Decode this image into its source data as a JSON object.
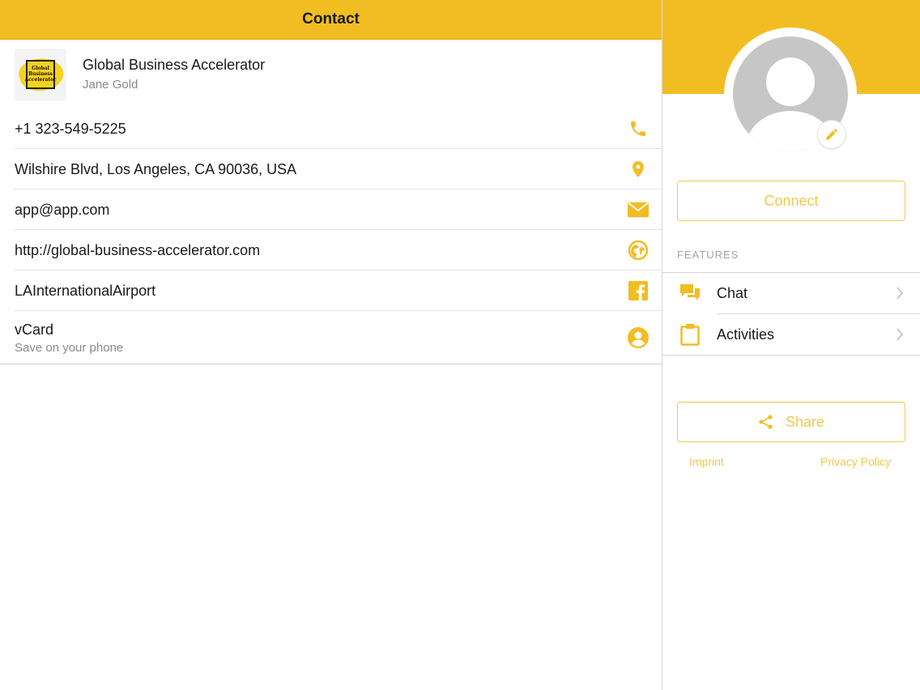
{
  "colors": {
    "accent": "#f1bd22",
    "accent_light": "#f1c84c",
    "icon": "#f1bd22"
  },
  "header": {
    "title": "Contact"
  },
  "company": {
    "logo_text": "Global Business Accelerator",
    "name": "Global Business Accelerator",
    "person": "Jane Gold"
  },
  "contact_rows": [
    {
      "text": "+1 323-549-5225",
      "icon": "phone-icon"
    },
    {
      "text": "Wilshire Blvd, Los Angeles, CA 90036, USA",
      "icon": "location-pin-icon"
    },
    {
      "text": "app@app.com",
      "icon": "envelope-icon"
    },
    {
      "text": "http://global-business-accelerator.com",
      "icon": "globe-icon"
    },
    {
      "text": "LAInternationalAirport",
      "icon": "facebook-icon"
    },
    {
      "text": "vCard",
      "subtext": "Save on your phone",
      "icon": "account-circle-icon"
    }
  ],
  "profile": {
    "avatar": "avatar-placeholder-icon",
    "edit_icon": "pencil-icon"
  },
  "connect": {
    "label": "Connect"
  },
  "features": {
    "label": "FEATURES",
    "items": [
      {
        "label": "Chat",
        "icon": "chat-bubbles-icon"
      },
      {
        "label": "Activities",
        "icon": "clipboard-icon"
      }
    ]
  },
  "share": {
    "label": "Share",
    "icon": "share-icon"
  },
  "footer": {
    "imprint": "Imprint",
    "privacy": "Privacy Policy"
  }
}
